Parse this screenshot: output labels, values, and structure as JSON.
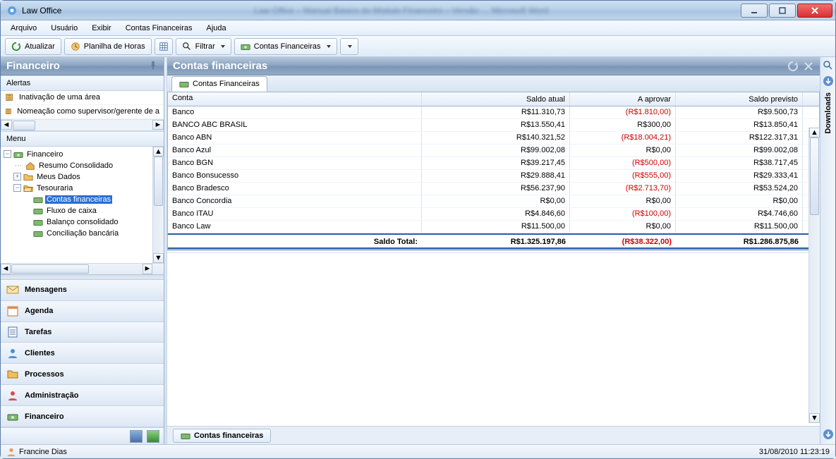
{
  "window": {
    "title": "Law Office",
    "blurred_bg_text": "Law Office – Manual Básico do Módulo Financeiro – Versão …  Microsoft Word"
  },
  "menubar": {
    "items": [
      "Arquivo",
      "Usuário",
      "Exibir",
      "Contas Financeiras",
      "Ajuda"
    ]
  },
  "toolbar": {
    "refresh_label": "Atualizar",
    "timesheet_label": "Planilha de Horas",
    "filter_label": "Filtrar",
    "accounts_label": "Contas Financeiras"
  },
  "sidebar": {
    "panel_title": "Financeiro",
    "alerts_header": "Alertas",
    "alerts": [
      "Inativação de uma área",
      "Nomeação como supervisor/gerente de a"
    ],
    "menu_header": "Menu",
    "tree": {
      "root": "Financeiro",
      "nodes": [
        {
          "label": "Resumo Consolidado"
        },
        {
          "label": "Meus Dados"
        },
        {
          "label": "Tesouraria",
          "children": [
            {
              "label": "Contas financeiras",
              "selected": true
            },
            {
              "label": "Fluxo de caixa"
            },
            {
              "label": "Balanço consolidado"
            },
            {
              "label": "Conciliação bancária"
            }
          ]
        }
      ]
    },
    "nav": [
      "Mensagens",
      "Agenda",
      "Tarefas",
      "Clientes",
      "Processos",
      "Administração",
      "Financeiro"
    ]
  },
  "main": {
    "header_title": "Contas financeiras",
    "tab_label": "Contas Financeiras",
    "columns": [
      "Conta",
      "Saldo atual",
      "A aprovar",
      "Saldo previsto"
    ],
    "rows": [
      {
        "conta": "Banco",
        "saldo": "R$11.310,73",
        "aprovar": "(R$1.810,00)",
        "previsto": "R$9.500,73",
        "neg": true
      },
      {
        "conta": "BANCO ABC BRASIL",
        "saldo": "R$13.550,41",
        "aprovar": "R$300,00",
        "previsto": "R$13.850,41",
        "neg": false
      },
      {
        "conta": "Banco ABN",
        "saldo": "R$140.321,52",
        "aprovar": "(R$18.004,21)",
        "previsto": "R$122.317,31",
        "neg": true
      },
      {
        "conta": "Banco Azul",
        "saldo": "R$99.002,08",
        "aprovar": "R$0,00",
        "previsto": "R$99.002,08",
        "neg": false
      },
      {
        "conta": "Banco BGN",
        "saldo": "R$39.217,45",
        "aprovar": "(R$500,00)",
        "previsto": "R$38.717,45",
        "neg": true
      },
      {
        "conta": "Banco Bonsucesso",
        "saldo": "R$29.888,41",
        "aprovar": "(R$555,00)",
        "previsto": "R$29.333,41",
        "neg": true
      },
      {
        "conta": "Banco Bradesco",
        "saldo": "R$56.237,90",
        "aprovar": "(R$2.713,70)",
        "previsto": "R$53.524,20",
        "neg": true
      },
      {
        "conta": "Banco Concordia",
        "saldo": "R$0,00",
        "aprovar": "R$0,00",
        "previsto": "R$0,00",
        "neg": false
      },
      {
        "conta": "Banco ITAU",
        "saldo": "R$4.846,60",
        "aprovar": "(R$100,00)",
        "previsto": "R$4.746,60",
        "neg": true
      },
      {
        "conta": "Banco Law",
        "saldo": "R$11.500,00",
        "aprovar": "R$0,00",
        "previsto": "R$11.500,00",
        "neg": false
      }
    ],
    "total_label": "Saldo Total:",
    "total_saldo": "R$1.325.197,86",
    "total_aprovar": "(R$38.322,00)",
    "total_previsto": "R$1.286.875,86",
    "doctab_label": "Contas financeiras"
  },
  "vbar": {
    "label": "Downloads"
  },
  "status": {
    "user": "Francine Dias",
    "datetime": "31/08/2010 11:23:19"
  },
  "icons": {
    "search": "search-icon",
    "refresh": "refresh-icon",
    "clock": "clock-icon",
    "grid": "grid-icon",
    "accounts": "accounts-icon"
  }
}
